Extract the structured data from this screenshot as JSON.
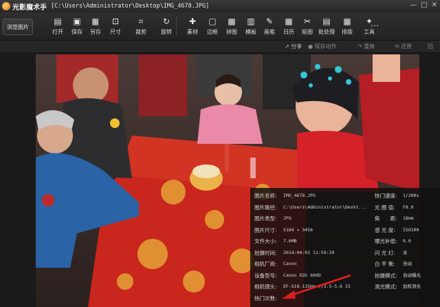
{
  "titlebar": {
    "app_name": "光影魔术手",
    "path": "[C:\\Users\\Administrator\\Desktop\\IMG_4678.JPG]",
    "min": "—",
    "max": "□",
    "close": "✕"
  },
  "toolbar": {
    "browse": "浏览图片",
    "tools": [
      {
        "label": "打开",
        "icon": "folder-icon",
        "glyph": "▤"
      },
      {
        "label": "保存",
        "icon": "save-icon",
        "glyph": "▣"
      },
      {
        "label": "另存",
        "icon": "save-as-icon",
        "glyph": "▦"
      },
      {
        "label": "尺寸",
        "icon": "resize-icon",
        "glyph": "⊡"
      },
      {
        "label": "裁剪",
        "icon": "crop-icon",
        "glyph": "⌗"
      },
      {
        "label": "旋转",
        "icon": "rotate-icon",
        "glyph": "↻"
      },
      {
        "label": "素材",
        "icon": "material-icon",
        "glyph": "✚"
      },
      {
        "label": "边框",
        "icon": "border-icon",
        "glyph": "▢"
      },
      {
        "label": "拼图",
        "icon": "collage-icon",
        "glyph": "▩"
      },
      {
        "label": "模板",
        "icon": "template-icon",
        "glyph": "▥"
      },
      {
        "label": "画笔",
        "icon": "brush-icon",
        "glyph": "✎"
      },
      {
        "label": "日历",
        "icon": "calendar-icon",
        "glyph": "▦"
      },
      {
        "label": "抠图",
        "icon": "cutout-icon",
        "glyph": "✂"
      },
      {
        "label": "批处理",
        "icon": "batch-icon",
        "glyph": "▤"
      },
      {
        "label": "排版",
        "icon": "layout-icon",
        "glyph": "▦"
      },
      {
        "label": "工具",
        "icon": "wrench-icon",
        "glyph": "✦"
      }
    ],
    "more": "⋯"
  },
  "subbar": {
    "share": "分享",
    "save_action": "保存动作",
    "redo": "重做",
    "restore": "还原",
    "extra": "回"
  },
  "info": {
    "left": [
      {
        "label": "图片名称:",
        "value": "IMG_4678.JPG"
      },
      {
        "label": "图片路径:",
        "value": "C:\\Users\\Administrator\\Deskt..."
      },
      {
        "label": "图片类型:",
        "value": "JPG"
      },
      {
        "label": "图片尺寸:",
        "value": "5184 × 3456"
      },
      {
        "label": "文件大小:",
        "value": "7.6MB"
      },
      {
        "label": "拍摄时间:",
        "value": "2014:04:01 11:59:39"
      },
      {
        "label": "相机厂商:",
        "value": "Canon"
      },
      {
        "label": "设备型号:",
        "value": "Canon EOS 600D"
      },
      {
        "label": "相机镜头:",
        "value": "EF-S18-135mm f/3.5-5.6 IS"
      },
      {
        "label": "快门次数:",
        "value": ""
      }
    ],
    "right": [
      {
        "label": "快门速度:",
        "value": "1/200s"
      },
      {
        "label": "光 圈 值:",
        "value": "F8.0"
      },
      {
        "label": "焦　　距:",
        "value": "18mm"
      },
      {
        "label": "感 光 度:",
        "value": "ISO100"
      },
      {
        "label": "曝光补偿:",
        "value": "0.0"
      },
      {
        "label": "闪 光 灯:",
        "value": "关"
      },
      {
        "label": "白 平 衡:",
        "value": "自动"
      },
      {
        "label": "拍摄模式:",
        "value": "自动曝光"
      },
      {
        "label": "测光模式:",
        "value": "加权测光"
      }
    ]
  },
  "colors": {
    "arrow": "#d81e1e",
    "tablecloth": "#c9261d",
    "gold": "#e8b43a"
  }
}
